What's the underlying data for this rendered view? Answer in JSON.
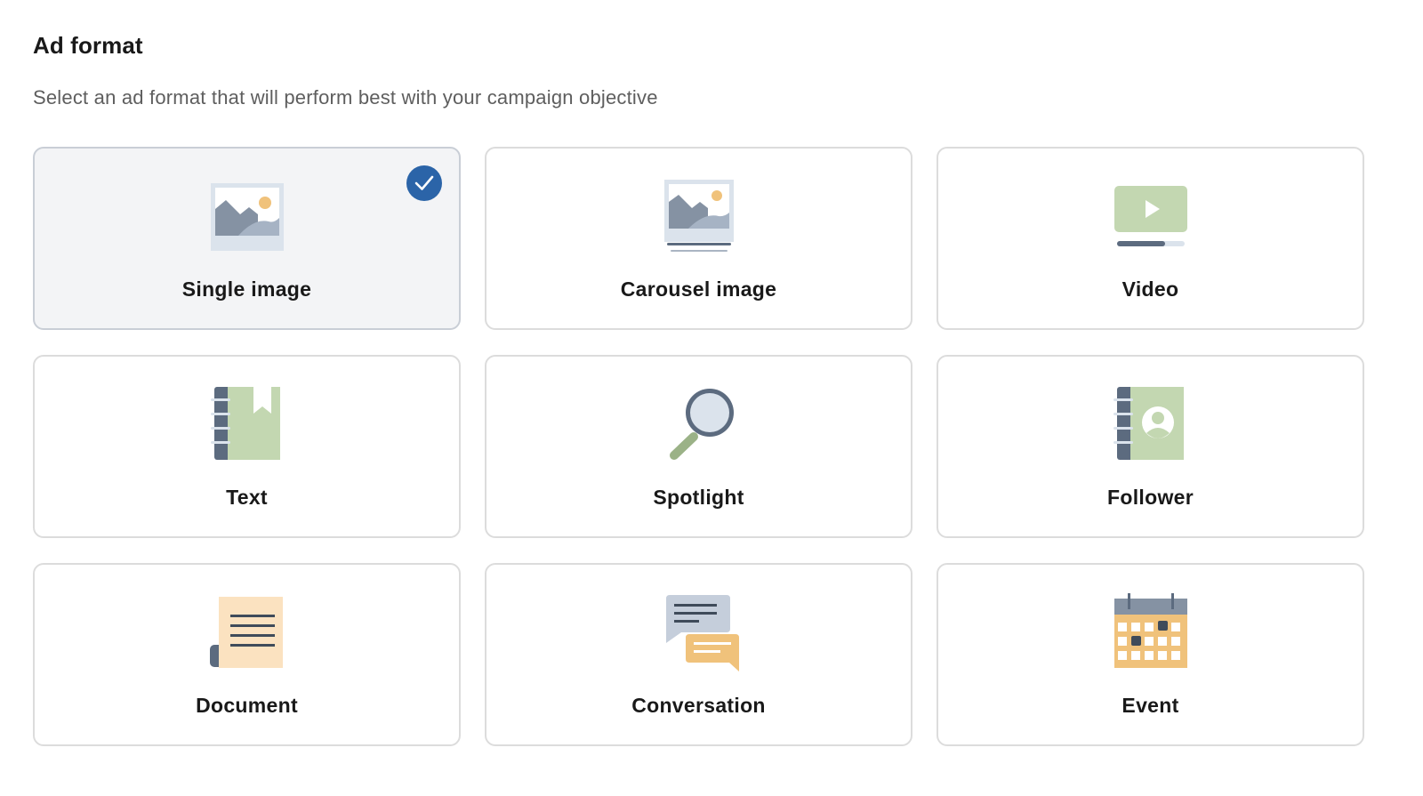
{
  "section": {
    "title": "Ad format",
    "subtitle": "Select an ad format that will perform best with your campaign objective"
  },
  "formats": [
    {
      "label": "Single image",
      "icon": "single-image-icon",
      "selected": true
    },
    {
      "label": "Carousel image",
      "icon": "carousel-image-icon",
      "selected": false
    },
    {
      "label": "Video",
      "icon": "video-icon",
      "selected": false
    },
    {
      "label": "Text",
      "icon": "text-book-icon",
      "selected": false
    },
    {
      "label": "Spotlight",
      "icon": "magnifier-icon",
      "selected": false
    },
    {
      "label": "Follower",
      "icon": "follower-contact-book-icon",
      "selected": false
    },
    {
      "label": "Document",
      "icon": "document-scroll-icon",
      "selected": false
    },
    {
      "label": "Conversation",
      "icon": "chat-bubbles-icon",
      "selected": false
    },
    {
      "label": "Event",
      "icon": "calendar-icon",
      "selected": false
    }
  ],
  "colors": {
    "selected_check": "#2b64a8",
    "selected_card_bg": "#f3f4f6",
    "card_border": "#dcdcdc"
  }
}
